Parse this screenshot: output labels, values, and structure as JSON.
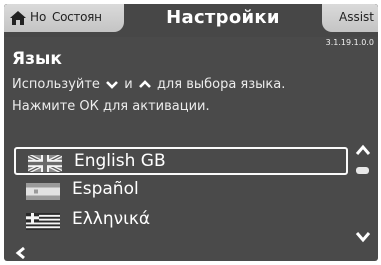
{
  "header": {
    "home_tab": {
      "label_1": "Но",
      "label_2": "Состоян",
      "icon": "home-icon"
    },
    "title": "Настройки",
    "assist_tab": {
      "label": "Assist"
    },
    "version": "3.1.19.1.0.0"
  },
  "section": {
    "title": "Язык",
    "instruction_line1": {
      "part1": "Используйте",
      "part2": "и",
      "part3": "для выбора языка."
    },
    "instruction_line2": "Нажмите ОК для активации."
  },
  "language_list": {
    "items": [
      {
        "label": "English GB",
        "flag": "uk-flag-icon",
        "selected": true
      },
      {
        "label": "Español",
        "flag": "spain-flag-icon",
        "selected": false
      },
      {
        "label": "Ελληνικά",
        "flag": "greece-flag-icon",
        "selected": false
      }
    ]
  },
  "colors": {
    "background": "#4a4a4a",
    "tab": "#d0d0d0",
    "text": "#ffffff"
  }
}
